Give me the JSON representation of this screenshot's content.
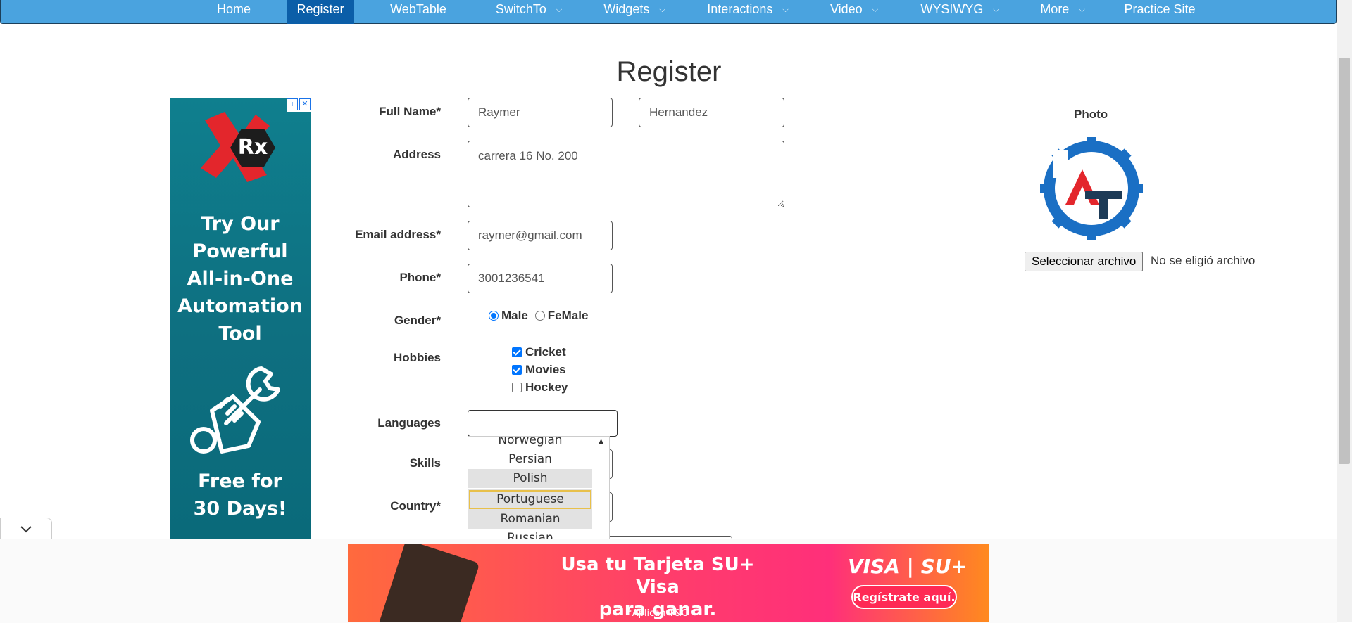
{
  "nav": {
    "items": [
      {
        "label": "Home",
        "dropdown": false,
        "active": false
      },
      {
        "label": "Register",
        "dropdown": false,
        "active": true
      },
      {
        "label": "WebTable",
        "dropdown": false,
        "active": false
      },
      {
        "label": "SwitchTo",
        "dropdown": true,
        "active": false
      },
      {
        "label": "Widgets",
        "dropdown": true,
        "active": false
      },
      {
        "label": "Interactions",
        "dropdown": true,
        "active": false
      },
      {
        "label": "Video",
        "dropdown": true,
        "active": false
      },
      {
        "label": "WYSIWYG",
        "dropdown": true,
        "active": false
      },
      {
        "label": "More",
        "dropdown": true,
        "active": false
      },
      {
        "label": "Practice Site",
        "dropdown": false,
        "active": false
      }
    ],
    "color": "#4aa3df",
    "active_color": "#0b5ea8"
  },
  "page": {
    "title": "Register"
  },
  "ad_left": {
    "logo_text": "Rx",
    "headline": [
      "Try Our",
      "Powerful",
      "All-in-One",
      "Automation",
      "Tool"
    ],
    "footer": [
      "Free for",
      "30 Days!"
    ]
  },
  "form": {
    "full_name_label": "Full Name*",
    "first_name": "Raymer",
    "last_name": "Hernandez",
    "address_label": "Address",
    "address": "carrera 16 No. 200",
    "email_label": "Email address*",
    "email": "raymer@gmail.com",
    "phone_label": "Phone*",
    "phone": "3001236541",
    "gender_label": "Gender*",
    "gender_options": [
      {
        "label": "Male",
        "checked": true
      },
      {
        "label": "FeMale",
        "checked": false
      }
    ],
    "hobbies_label": "Hobbies",
    "hobbies": [
      {
        "label": "Cricket",
        "checked": true
      },
      {
        "label": "Movies",
        "checked": true
      },
      {
        "label": "Hockey",
        "checked": false
      }
    ],
    "languages_label": "Languages",
    "languages_value": "",
    "skills_label": "Skills",
    "country_label": "Country*"
  },
  "language_dropdown": {
    "options": [
      "Norwegian",
      "Persian",
      "Polish",
      "Portuguese",
      "Romanian",
      "Russian"
    ],
    "focused": "Portuguese"
  },
  "photo": {
    "label": "Photo",
    "choose_button": "Seleccionar archivo",
    "status": "No se eligió archivo"
  },
  "bottom_ad": {
    "headline": [
      "Usa tu Tarjeta SU+ Visa",
      "para ganar."
    ],
    "footnote": "*Aplican T&C",
    "brand": "VISA | SU+",
    "cta": "Regístrate aquí."
  }
}
